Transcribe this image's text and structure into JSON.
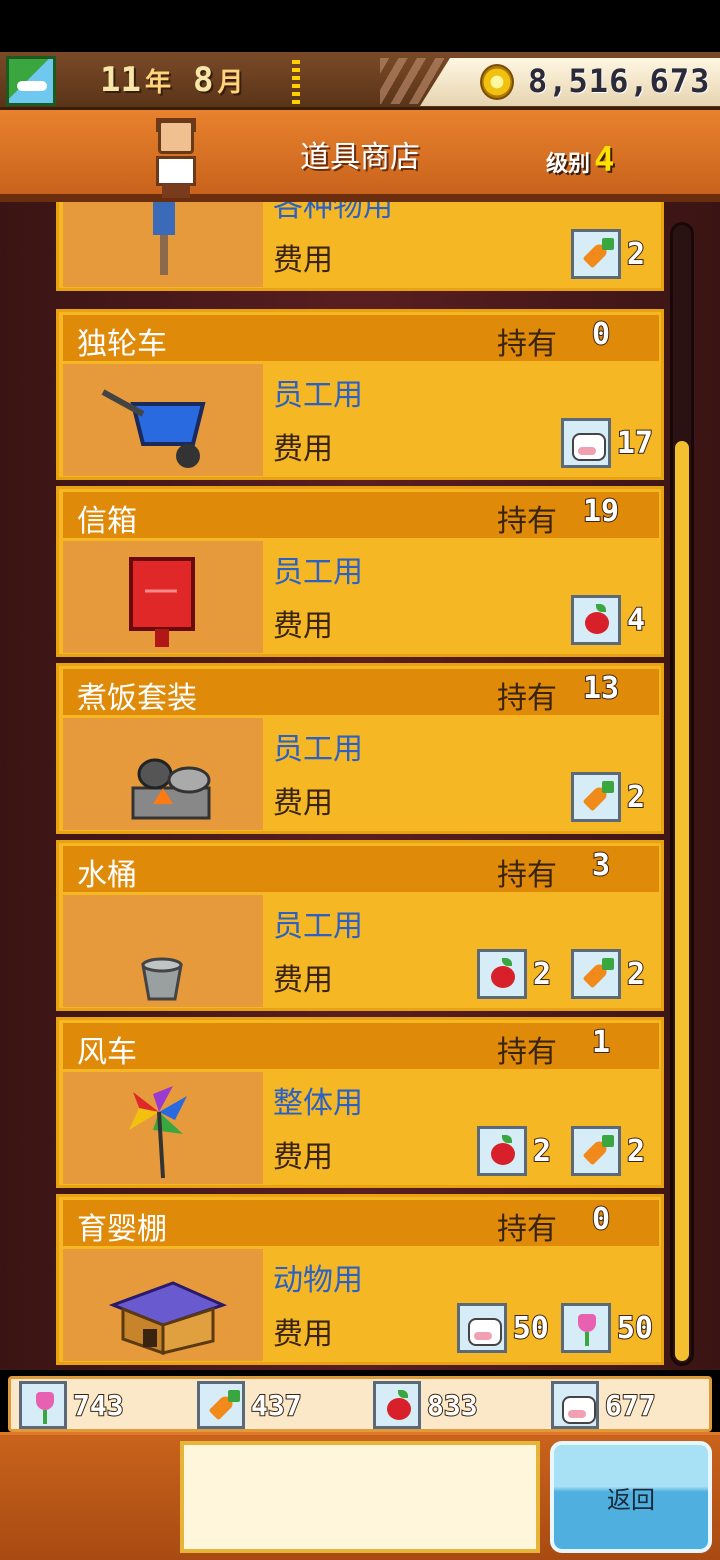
{
  "header": {
    "year": "11",
    "year_unit": "年",
    "month": "8",
    "month_unit": "月",
    "money": "8,516,673"
  },
  "shop": {
    "title": "道具商店",
    "level_label": "级别",
    "level": "4"
  },
  "labels": {
    "owned": "持有",
    "cost": "费用"
  },
  "first_item": {
    "usage": "各种物用",
    "cost": [
      {
        "icon": "carrot-icon",
        "value": "2"
      }
    ]
  },
  "items": [
    {
      "name": "独轮车",
      "owned": "0",
      "usage": "员工用",
      "thumb": "wheelbarrow-image",
      "cost": [
        {
          "icon": "cow-icon",
          "value": "17"
        }
      ]
    },
    {
      "name": "信箱",
      "owned": "19",
      "usage": "员工用",
      "thumb": "mailbox-image",
      "cost": [
        {
          "icon": "apple-icon",
          "value": "4"
        }
      ]
    },
    {
      "name": "煮饭套装",
      "owned": "13",
      "usage": "员工用",
      "thumb": "cooking-set-image",
      "cost": [
        {
          "icon": "carrot-icon",
          "value": "2"
        }
      ]
    },
    {
      "name": "水桶",
      "owned": "3",
      "usage": "员工用",
      "thumb": "bucket-image",
      "cost": [
        {
          "icon": "apple-icon",
          "value": "2"
        },
        {
          "icon": "carrot-icon",
          "value": "2"
        }
      ]
    },
    {
      "name": "风车",
      "owned": "1",
      "usage": "整体用",
      "thumb": "pinwheel-image",
      "cost": [
        {
          "icon": "apple-icon",
          "value": "2"
        },
        {
          "icon": "carrot-icon",
          "value": "2"
        }
      ]
    },
    {
      "name": "育婴棚",
      "owned": "0",
      "usage": "动物用",
      "thumb": "doghouse-image",
      "cost": [
        {
          "icon": "cow-icon",
          "value": "50"
        },
        {
          "icon": "tulip-icon",
          "value": "50"
        }
      ]
    }
  ],
  "resources": [
    {
      "icon": "tulip-icon",
      "value": "743"
    },
    {
      "icon": "carrot-icon",
      "value": "437"
    },
    {
      "icon": "apple-icon",
      "value": "833"
    },
    {
      "icon": "cow-icon",
      "value": "677"
    }
  ],
  "footer": {
    "back_label": "返回",
    "message": ""
  },
  "colors": {
    "item_bg": "#f5b824",
    "item_header": "#e08a0a",
    "usage_text": "#2b61c4",
    "back_button": "#4fb0e0"
  }
}
